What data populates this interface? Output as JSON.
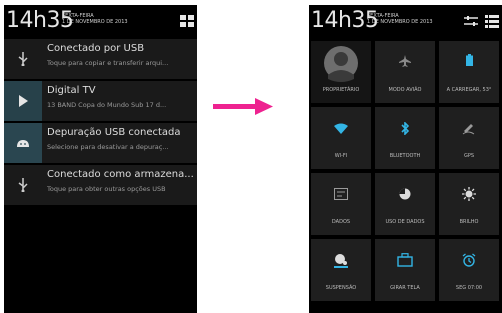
{
  "left": {
    "time": "14h35",
    "weekday": "SEXTA-FEIRA",
    "date": "1 DE NOVEMBRO DE 2013",
    "notifications": [
      {
        "title": "Conectado por USB",
        "subtitle": "Toque para copiar e transferir arqui...",
        "icon": "usb-icon"
      },
      {
        "title": "Digital TV",
        "subtitle": "13 BAND  Copa do Mundo Sub 17 d...",
        "icon": "play-icon"
      },
      {
        "title": "Depuração USB conectada",
        "subtitle": "Selecione para desativar a depuraç...",
        "icon": "android-icon"
      },
      {
        "title": "Conectado como armazena...",
        "subtitle": "Toque para obter outras opções USB",
        "icon": "usb-icon"
      }
    ]
  },
  "right": {
    "time": "14h35",
    "weekday": "SEXTA-FEIRA",
    "date": "1 DE NOVEMBRO DE 2013",
    "tiles": [
      {
        "label": "PROPRIETÁRIO",
        "icon": "user-icon",
        "color": "#9a9a9a"
      },
      {
        "label": "MODO AVIÃO",
        "icon": "airplane-icon",
        "color": "#8a8a8a"
      },
      {
        "label": "A CARREGAR, 53°",
        "icon": "battery-icon",
        "color": "#33b5e5"
      },
      {
        "label": "WI-FI",
        "icon": "wifi-icon",
        "color": "#33b5e5"
      },
      {
        "label": "BLUETOOTH",
        "icon": "bluetooth-icon",
        "color": "#33b5e5"
      },
      {
        "label": "GPS",
        "icon": "gps-icon",
        "color": "#9a9a9a"
      },
      {
        "label": "DADOS",
        "icon": "data-icon",
        "color": "#9a9a9a"
      },
      {
        "label": "USO DE DADOS",
        "icon": "data-usage-icon",
        "color": "#dcdcdc"
      },
      {
        "label": "BRILHO",
        "icon": "brightness-icon",
        "color": "#dcdcdc"
      },
      {
        "label": "SUSPENSÃO",
        "icon": "sleep-icon",
        "color": "#33b5e5"
      },
      {
        "label": "GIRAR TELA",
        "icon": "rotate-icon",
        "color": "#33b5e5"
      },
      {
        "label": "SEG 07:00",
        "icon": "alarm-icon",
        "color": "#33b5e5"
      }
    ]
  },
  "colors": {
    "accent": "#33b5e5",
    "arrow": "#ee2290"
  }
}
